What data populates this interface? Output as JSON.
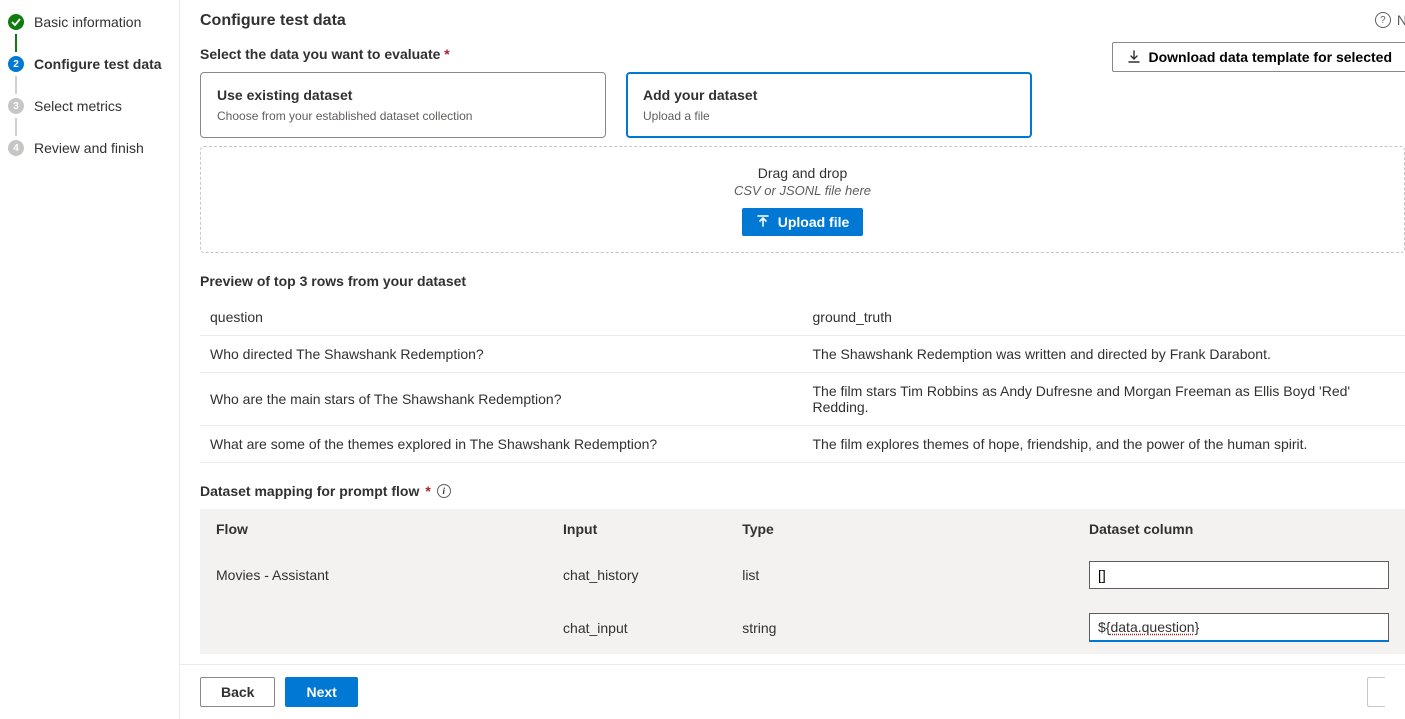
{
  "sidebar": {
    "steps": [
      {
        "label": "Basic information"
      },
      {
        "label": "Configure test data"
      },
      {
        "label": "Select metrics"
      },
      {
        "label": "Review and finish"
      }
    ]
  },
  "header": {
    "title": "Configure test data",
    "help_suffix": "N"
  },
  "select_data": {
    "label": "Select the data you want to evaluate",
    "download_button": "Download data template for selected",
    "cards": [
      {
        "title": "Use existing dataset",
        "sub": "Choose from your established dataset collection"
      },
      {
        "title": "Add your dataset",
        "sub": "Upload a file"
      }
    ]
  },
  "dropzone": {
    "title": "Drag and drop",
    "sub": "CSV or JSONL file here",
    "button": "Upload file"
  },
  "preview": {
    "title": "Preview of top 3 rows from your dataset",
    "columns": [
      "question",
      "ground_truth"
    ],
    "rows": [
      {
        "c0": "Who directed The Shawshank Redemption?",
        "c1": "The Shawshank Redemption was written and directed by Frank Darabont."
      },
      {
        "c0": "Who are the main stars of The Shawshank Redemption?",
        "c1": "The film stars Tim Robbins as Andy Dufresne and Morgan Freeman as Ellis Boyd 'Red' Redding."
      },
      {
        "c0": "What are some of the themes explored in The Shawshank Redemption?",
        "c1": "The film explores themes of hope, friendship, and the power of the human spirit."
      }
    ]
  },
  "mapping": {
    "title": "Dataset mapping for prompt flow",
    "columns": [
      "Flow",
      "Input",
      "Type",
      "Dataset column"
    ],
    "rows": [
      {
        "flow": "Movies - Assistant",
        "input": "chat_history",
        "type": "list",
        "value": "[]"
      },
      {
        "flow": "",
        "input": "chat_input",
        "type": "string",
        "value": "${data.question}"
      }
    ]
  },
  "footer": {
    "back": "Back",
    "next": "Next"
  }
}
